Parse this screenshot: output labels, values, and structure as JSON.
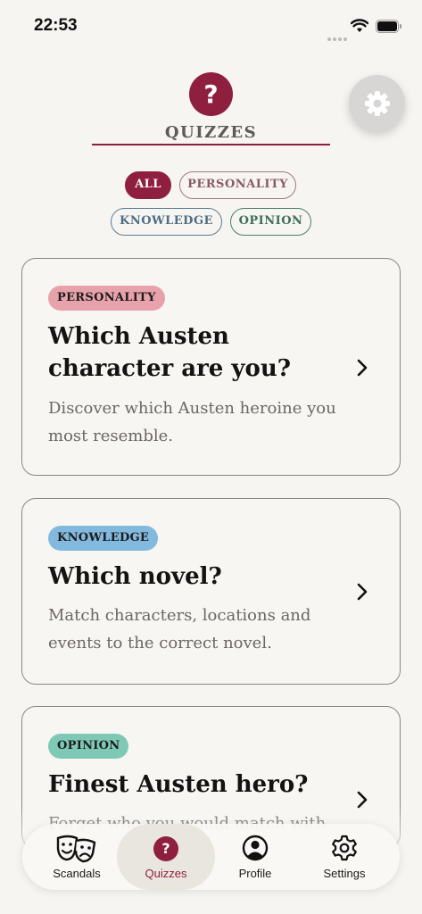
{
  "status_bar": {
    "time": "22:53"
  },
  "header": {
    "badge": "?",
    "title": "QUIZZES"
  },
  "filters": [
    {
      "label": "ALL",
      "selected": true
    },
    {
      "label": "PERSONALITY",
      "selected": false
    },
    {
      "label": "KNOWLEDGE",
      "selected": false
    },
    {
      "label": "OPINION",
      "selected": false
    }
  ],
  "quizzes": [
    {
      "tag": "PERSONALITY",
      "title": "Which Austen character are you?",
      "description": "Discover which Austen heroine you most resemble."
    },
    {
      "tag": "KNOWLEDGE",
      "title": "Which novel?",
      "description": "Match characters, locations and events to the correct novel."
    },
    {
      "tag": "OPINION",
      "title": "Finest Austen hero?",
      "description": "Forget who you would match with"
    }
  ],
  "tab_bar": {
    "tabs": [
      {
        "label": "Scandals",
        "icon": "theater-masks-icon"
      },
      {
        "label": "Quizzes",
        "icon": "question-badge-icon",
        "active": true
      },
      {
        "label": "Profile",
        "icon": "person-circle-icon"
      },
      {
        "label": "Settings",
        "icon": "gear-icon"
      }
    ]
  },
  "colors": {
    "accent": "#8f1f3f",
    "background": "#f7f5f1",
    "tag_personality": "#e8a2ac",
    "tag_knowledge": "#82b9df",
    "tag_opinion": "#7ec8b6"
  }
}
